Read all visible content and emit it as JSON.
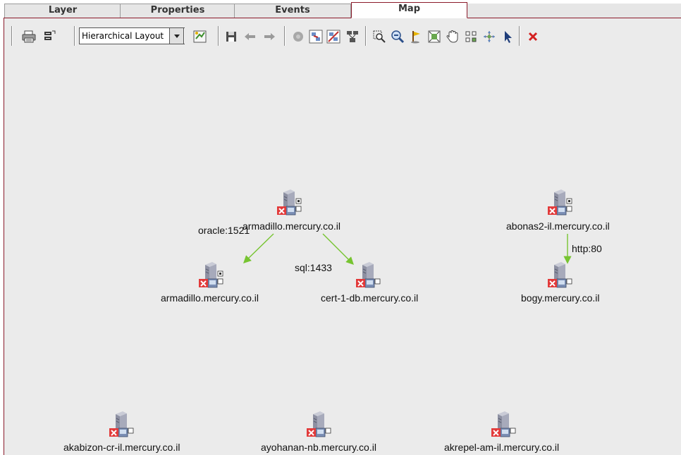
{
  "tabs": [
    {
      "label": "Layer",
      "active": false
    },
    {
      "label": "Properties",
      "active": false
    },
    {
      "label": "Events",
      "active": false
    },
    {
      "label": "Map",
      "active": true
    }
  ],
  "toolbar": {
    "layout_selected": "Hierarchical Layout",
    "icons": [
      "print-icon",
      "page-setup-icon",
      "apply-layout-icon",
      "save-icon",
      "back-arrow-icon",
      "forward-arrow-icon",
      "disc-icon",
      "show-related-icon",
      "hide-related-icon",
      "map-overview-icon",
      "zoom-select-icon",
      "zoom-out-icon",
      "pin-icon",
      "fit-window-icon",
      "pan-hand-icon",
      "group-icon",
      "expand-icon",
      "select-pointer-icon",
      "delete-icon"
    ]
  },
  "colors": {
    "tab_active_border": "#8b1a2a",
    "edge": "#77c431",
    "error_badge": "#e23a3a",
    "canvas_bg": "#ebebeb"
  },
  "map": {
    "nodes": [
      {
        "label": "armadillo.mercury.co.il"
      },
      {
        "label": "abonas2-il.mercury.co.il"
      },
      {
        "label": "armadillo.mercury.co.il"
      },
      {
        "label": "cert-1-db.mercury.co.il"
      },
      {
        "label": "bogy.mercury.co.il"
      },
      {
        "label": "akabizon-cr-il.mercury.co.il"
      },
      {
        "label": "ayohanan-nb.mercury.co.il"
      },
      {
        "label": "akrepel-am-il.mercury.co.il"
      }
    ],
    "edges": [
      {
        "label": "oracle:1521"
      },
      {
        "label": "sql:1433"
      },
      {
        "label": "http:80"
      }
    ]
  }
}
